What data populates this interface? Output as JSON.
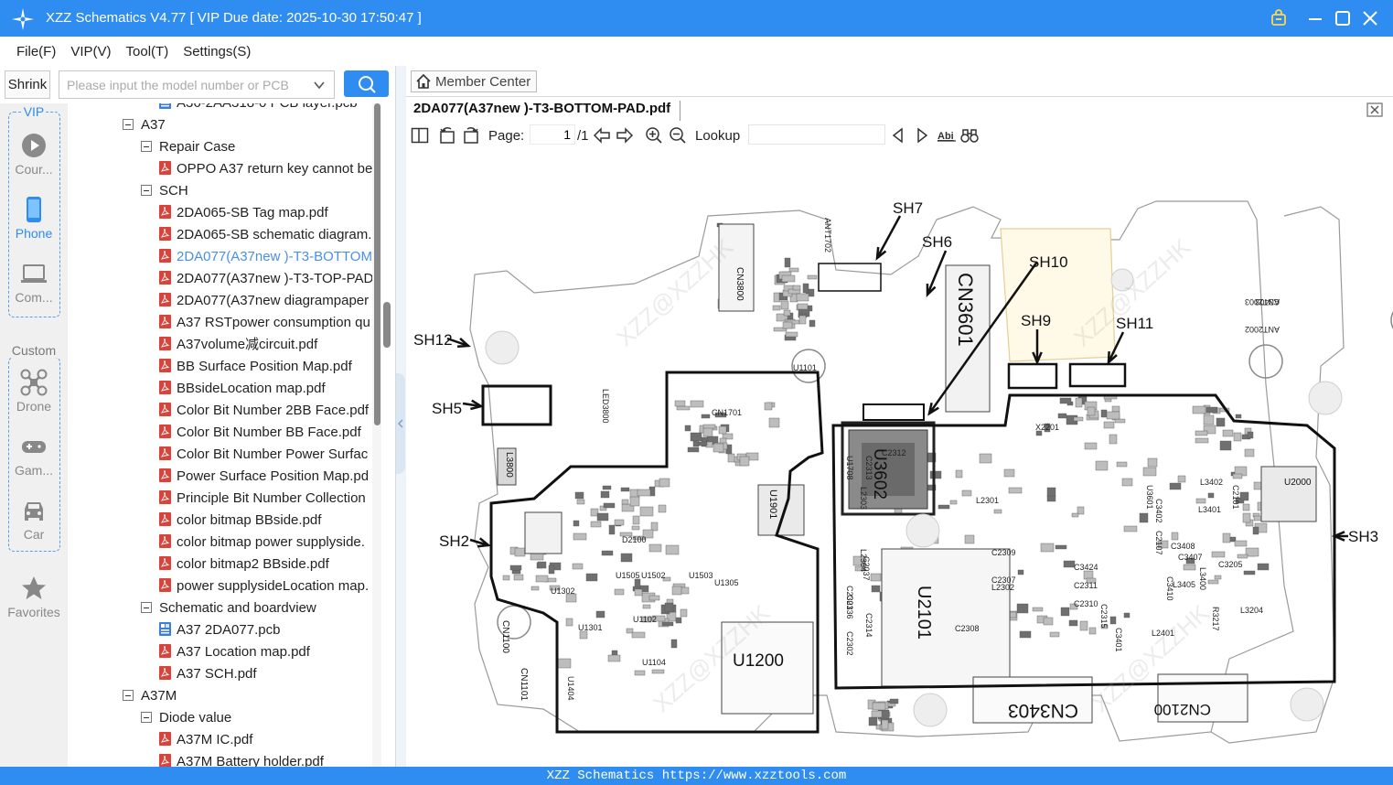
{
  "window": {
    "title": "XZZ Schematics V4.77 [ VIP Due date: 2025-10-30 17:50:47 ]"
  },
  "menu": [
    "File(F)",
    "VIP(V)",
    "Tool(T)",
    "Settings(S)"
  ],
  "search": {
    "shrink_label": "Shrink",
    "placeholder": "Please input the model number or PCB"
  },
  "rail": {
    "vip_label": "VIP",
    "custom_label": "Custom",
    "vip_items": [
      {
        "label": "Cour...",
        "icon": "play-circle-icon"
      },
      {
        "label": "Phone",
        "icon": "phone-icon"
      },
      {
        "label": "Com...",
        "icon": "laptop-icon"
      }
    ],
    "custom_items": [
      {
        "label": "Drone",
        "icon": "drone-icon"
      },
      {
        "label": "Gam...",
        "icon": "gamepad-icon"
      },
      {
        "label": "Car",
        "icon": "car-icon"
      }
    ],
    "favorites_label": "Favorites"
  },
  "tree": [
    {
      "level": 2,
      "type": "pcb",
      "label": "A36-2AA318-0 PCB layer.pcb"
    },
    {
      "level": 0,
      "type": "folder",
      "label": "A37"
    },
    {
      "level": 1,
      "type": "folder",
      "label": "Repair Case"
    },
    {
      "level": 2,
      "type": "pdf",
      "label": "OPPO A37 return key cannot be"
    },
    {
      "level": 1,
      "type": "folder",
      "label": "SCH"
    },
    {
      "level": 2,
      "type": "pdf",
      "label": "2DA065-SB Tag map.pdf"
    },
    {
      "level": 2,
      "type": "pdf",
      "label": "2DA065-SB schematic diagram."
    },
    {
      "level": 2,
      "type": "pdf",
      "label": "2DA077(A37new )-T3-BOTTOM",
      "selected": true
    },
    {
      "level": 2,
      "type": "pdf",
      "label": "2DA077(A37new )-T3-TOP-PAD"
    },
    {
      "level": 2,
      "type": "pdf",
      "label": "2DA077(A37new diagrampaper"
    },
    {
      "level": 2,
      "type": "pdf",
      "label": "A37 RSTpower consumption qu"
    },
    {
      "level": 2,
      "type": "pdf",
      "label": "A37volume减circuit.pdf"
    },
    {
      "level": 2,
      "type": "pdf",
      "label": "BB Surface Position Map.pdf"
    },
    {
      "level": 2,
      "type": "pdf",
      "label": "BBsideLocation map.pdf"
    },
    {
      "level": 2,
      "type": "pdf",
      "label": "Color Bit Number 2BB Face.pdf"
    },
    {
      "level": 2,
      "type": "pdf",
      "label": "Color Bit Number BB Face.pdf"
    },
    {
      "level": 2,
      "type": "pdf",
      "label": "Color Bit Number Power Surfac"
    },
    {
      "level": 2,
      "type": "pdf",
      "label": "Power Surface Position Map.pd"
    },
    {
      "level": 2,
      "type": "pdf",
      "label": "Principle Bit Number Collection"
    },
    {
      "level": 2,
      "type": "pdf",
      "label": "color bitmap BBside.pdf"
    },
    {
      "level": 2,
      "type": "pdf",
      "label": "color bitmap power supplyside."
    },
    {
      "level": 2,
      "type": "pdf",
      "label": "color bitmap2 BBside.pdf"
    },
    {
      "level": 2,
      "type": "pdf",
      "label": "power supplysideLocation map."
    },
    {
      "level": 1,
      "type": "folder",
      "label": "Schematic and boardview"
    },
    {
      "level": 2,
      "type": "pcb",
      "label": "A37 2DA077.pcb"
    },
    {
      "level": 2,
      "type": "pdf",
      "label": "A37 Location map.pdf"
    },
    {
      "level": 2,
      "type": "pdf",
      "label": "A37 SCH.pdf"
    },
    {
      "level": 0,
      "type": "folder",
      "label": "A37M"
    },
    {
      "level": 1,
      "type": "folder",
      "label": "Diode value"
    },
    {
      "level": 2,
      "type": "pdf",
      "label": "A37M  IC.pdf"
    },
    {
      "level": 2,
      "type": "pdf",
      "label": "A37M Battery holder.pdf"
    }
  ],
  "viewer": {
    "member_center": "Member Center",
    "doc_tab": "2DA077(A37new )-T3-BOTTOM-PAD.pdf",
    "page_label": "Page:",
    "page_current": "1",
    "page_total": "/1",
    "lookup_label": "Lookup"
  },
  "pcb": {
    "shields": [
      "SH7",
      "SH6",
      "SH10",
      "SH9",
      "SH11",
      "SH12",
      "SH5",
      "SH2",
      "SH3"
    ],
    "big_parts": [
      "CN3601",
      "U3602",
      "U2101",
      "U1200",
      "CN3403",
      "CN2100",
      "CN3800",
      "CN1100",
      "CN1101",
      "U1901",
      "U2000",
      "L3800"
    ],
    "small_parts": [
      "ANT2003",
      "ANT2002",
      "ANT1702",
      "X2201",
      "LED3800",
      "L3402",
      "L3401",
      "L2301",
      "L2303",
      "L2304",
      "L2302",
      "L3400",
      "C3205",
      "R3217",
      "L3204",
      "C3410",
      "L3405",
      "C3407",
      "C3408",
      "C3424",
      "C2311",
      "C2310",
      "C2309",
      "C2307",
      "C2308",
      "L2401",
      "D2100",
      "U1505",
      "U1502",
      "U1503",
      "U1305",
      "U1301",
      "U1102",
      "U1104",
      "U1302",
      "U1404",
      "U1101",
      "CN1701",
      "U1708",
      "C2313",
      "C2312",
      "C2336",
      "C2314",
      "C2302",
      "C2301",
      "C2315",
      "C2107",
      "C3401",
      "C2101",
      "C2037",
      "U3601",
      "C3402",
      "C3403"
    ],
    "watermark": "XZZ@XZZHK"
  },
  "status": {
    "text": "XZZ Schematics https://www.xzztools.com"
  },
  "colors": {
    "accent": "#2f8cf0",
    "selected_text": "#4a90e2",
    "pdf_icon": "#d9443a",
    "pcb_icon": "#3d7fd6"
  }
}
